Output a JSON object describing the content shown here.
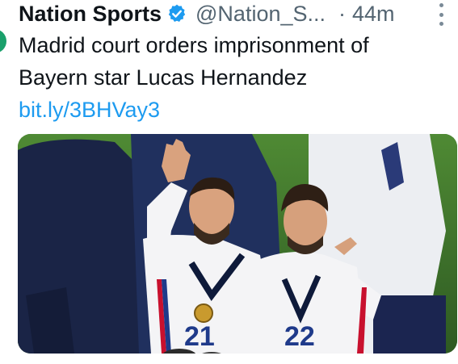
{
  "tweet": {
    "author_name": "Nation Sports",
    "handle": "@Nation_S...",
    "separator": "·",
    "time": "44m",
    "line1": "Madrid court orders imprisonment of",
    "line2": "Bayern star Lucas Hernandez",
    "link": "bit.ly/3BHVay3"
  },
  "media": {
    "jersey_numbers": [
      "21",
      "22"
    ]
  },
  "colors": {
    "text": "#0f1419",
    "secondary": "#536471",
    "link": "#1d9bf0",
    "verified": "#1d9bf0",
    "pitch": "#3e6b2e"
  },
  "icons": {
    "verified": "verified-badge-icon",
    "more": "more-options-icon"
  }
}
